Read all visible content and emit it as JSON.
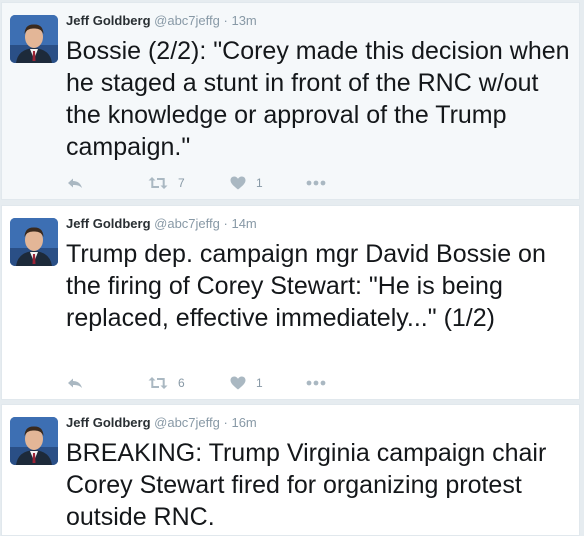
{
  "colors": {
    "name": "#292f33",
    "meta": "#8899a6",
    "icon": "#aab8c2",
    "text": "#14171a"
  },
  "icons": {
    "reply": "reply-icon",
    "retweet": "retweet-icon",
    "like": "heart-icon",
    "more": "more-icon"
  },
  "tweets": [
    {
      "author": "Jeff Goldberg",
      "handle": "@abc7jeffg",
      "separator": "·",
      "time": "13m",
      "text": "Bossie (2/2): \"Corey made this decision when he staged a stunt in front of the RNC w/out the knowledge or approval of the Trump campaign.\"",
      "retweets": "7",
      "likes": "1"
    },
    {
      "author": "Jeff Goldberg",
      "handle": "@abc7jeffg",
      "separator": "·",
      "time": "14m",
      "text": "Trump dep. campaign mgr David Bossie on the firing of Corey Stewart: \"He is being replaced, effective immediately...\" (1/2)",
      "retweets": "6",
      "likes": "1"
    },
    {
      "author": "Jeff Goldberg",
      "handle": "@abc7jeffg",
      "separator": "·",
      "time": "16m",
      "text": "BREAKING: Trump Virginia campaign chair Corey Stewart fired for organizing protest outside RNC."
    }
  ]
}
